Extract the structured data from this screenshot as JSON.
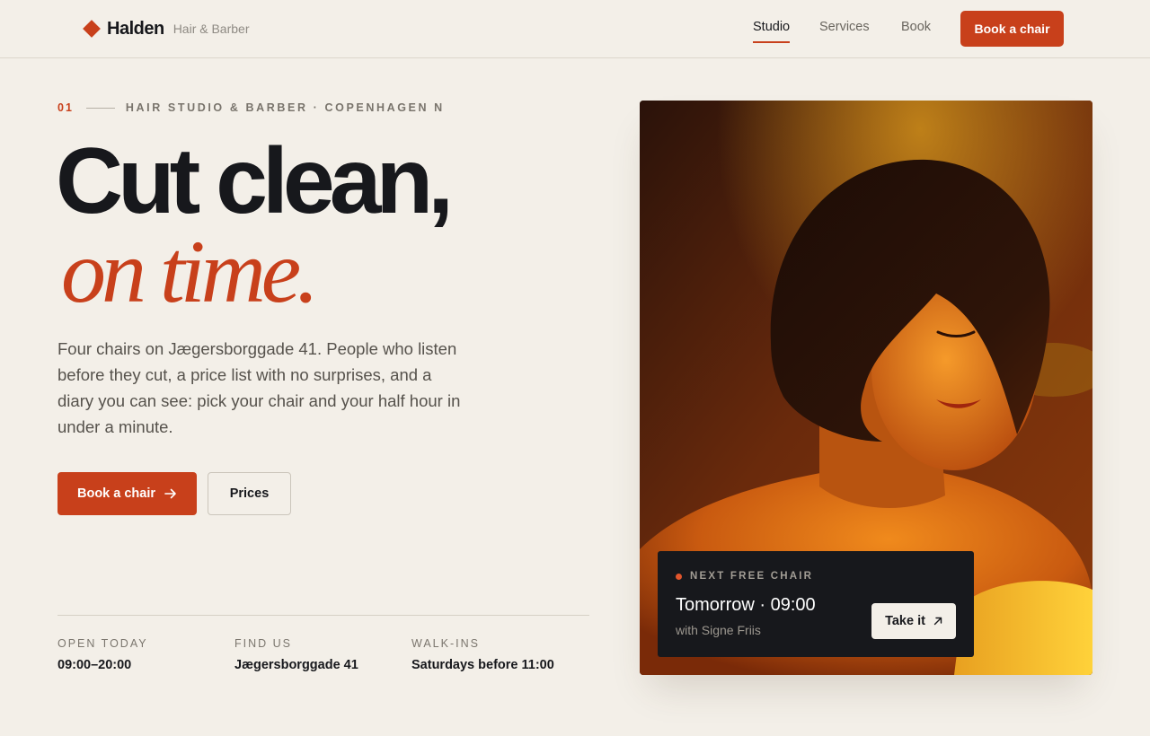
{
  "brand": {
    "name": "Halden",
    "tagline": "Hair & Barber"
  },
  "nav": {
    "items": [
      {
        "label": "Studio",
        "active": true
      },
      {
        "label": "Services",
        "active": false
      },
      {
        "label": "Book",
        "active": false
      }
    ],
    "cta_label": "Book a chair"
  },
  "hero": {
    "eyebrow_number": "01",
    "eyebrow_text": "HAIR STUDIO & BARBER · COPENHAGEN N",
    "headline_line1": "Cut clean,",
    "headline_line2": "on time.",
    "lede": "Four chairs on Jægersborggade 41. People who listen before they cut, a price list with no surprises, and a diary you can see: pick your chair and your half hour in under a minute.",
    "primary_button": "Book a chair",
    "primary_button_icon": "arrow-right-icon",
    "secondary_button": "Prices"
  },
  "info": [
    {
      "label": "OPEN TODAY",
      "value": "09:00–20:00"
    },
    {
      "label": "FIND US",
      "value": "Jægersborggade 41"
    },
    {
      "label": "WALK-INS",
      "value": "Saturdays before 11:00"
    }
  ],
  "next_chair": {
    "label": "NEXT FREE CHAIR",
    "time": "Tomorrow · 09:00",
    "barber": "with Signe Friis",
    "button": "Take it",
    "button_icon": "arrow-up-right-icon"
  },
  "colors": {
    "accent": "#c8401b",
    "background": "#f3efe8",
    "ink": "#17181c",
    "card": "#17181c"
  }
}
